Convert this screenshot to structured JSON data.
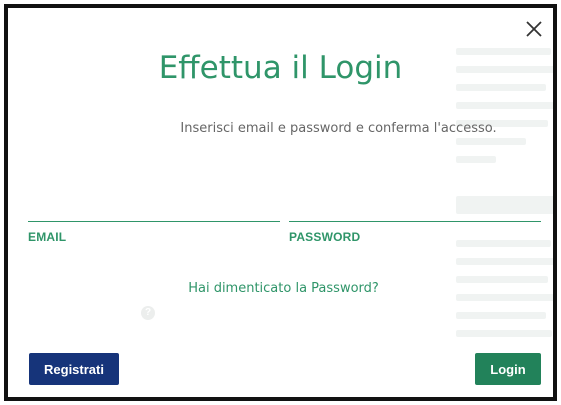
{
  "dialog": {
    "title": "Effettua il Login",
    "subtitle": "Inserisci email e password e conferma l'accesso.",
    "email": {
      "label": "EMAIL",
      "value": "",
      "placeholder": ""
    },
    "password": {
      "label": "PASSWORD",
      "value": "",
      "placeholder": ""
    },
    "forgot_link": "Hai dimenticato la Password?",
    "register_button": "Registrati",
    "login_button": "Login",
    "close_icon": "close-icon",
    "help_icon": "help-icon"
  },
  "colors": {
    "accent": "#2f9569",
    "register": "#16347a",
    "login": "#22825a",
    "border": "#111111"
  }
}
